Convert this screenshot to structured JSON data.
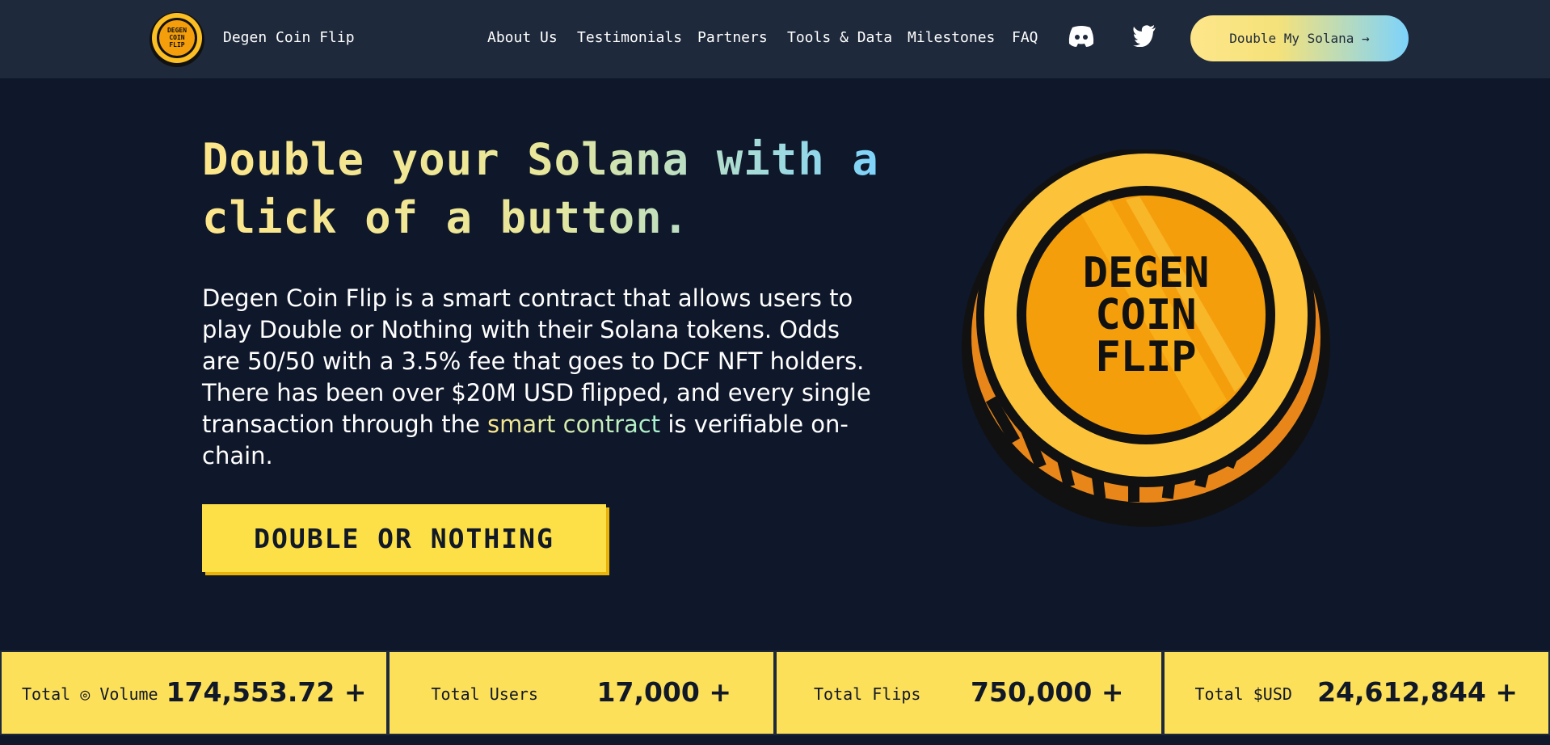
{
  "header": {
    "brand": "Degen Coin Flip",
    "logo_text": [
      "DEGEN",
      "COIN",
      "FLIP"
    ],
    "nav": [
      "About Us",
      "Testimonials",
      "Partners",
      "Tools & Data",
      "Milestones",
      "FAQ"
    ],
    "social_icons": [
      "discord-icon",
      "twitter-icon"
    ],
    "cta_label": "Double My Solana →"
  },
  "hero": {
    "title": "Double your Solana with a click of a button.",
    "description_before": "Degen Coin Flip is a smart contract that allows users to play Double or Nothing with their Solana tokens. Odds are 50/50 with a 3.5% fee that goes to DCF NFT holders. There has been over $20M USD flipped, and every single transaction through the ",
    "description_link": "smart contract",
    "description_after": " is verifiable on-chain.",
    "button_label": "DOUBLE OR NOTHING",
    "coin_text": [
      "DEGEN",
      "COIN",
      "FLIP"
    ]
  },
  "stats": [
    {
      "label": "Total ◎ Volume",
      "value": "174,553.72 +"
    },
    {
      "label": "Total Users",
      "value": "17,000 +"
    },
    {
      "label": "Total Flips",
      "value": "750,000 +"
    },
    {
      "label": "Total $USD",
      "value": "24,612,844 +"
    }
  ],
  "colors": {
    "background": "#0f172a",
    "header": "#1e293b",
    "accent_yellow": "#fde047",
    "accent_blue": "#7dd3fc",
    "coin_gold": "#fbbf24",
    "coin_orange": "#f59e0b"
  }
}
